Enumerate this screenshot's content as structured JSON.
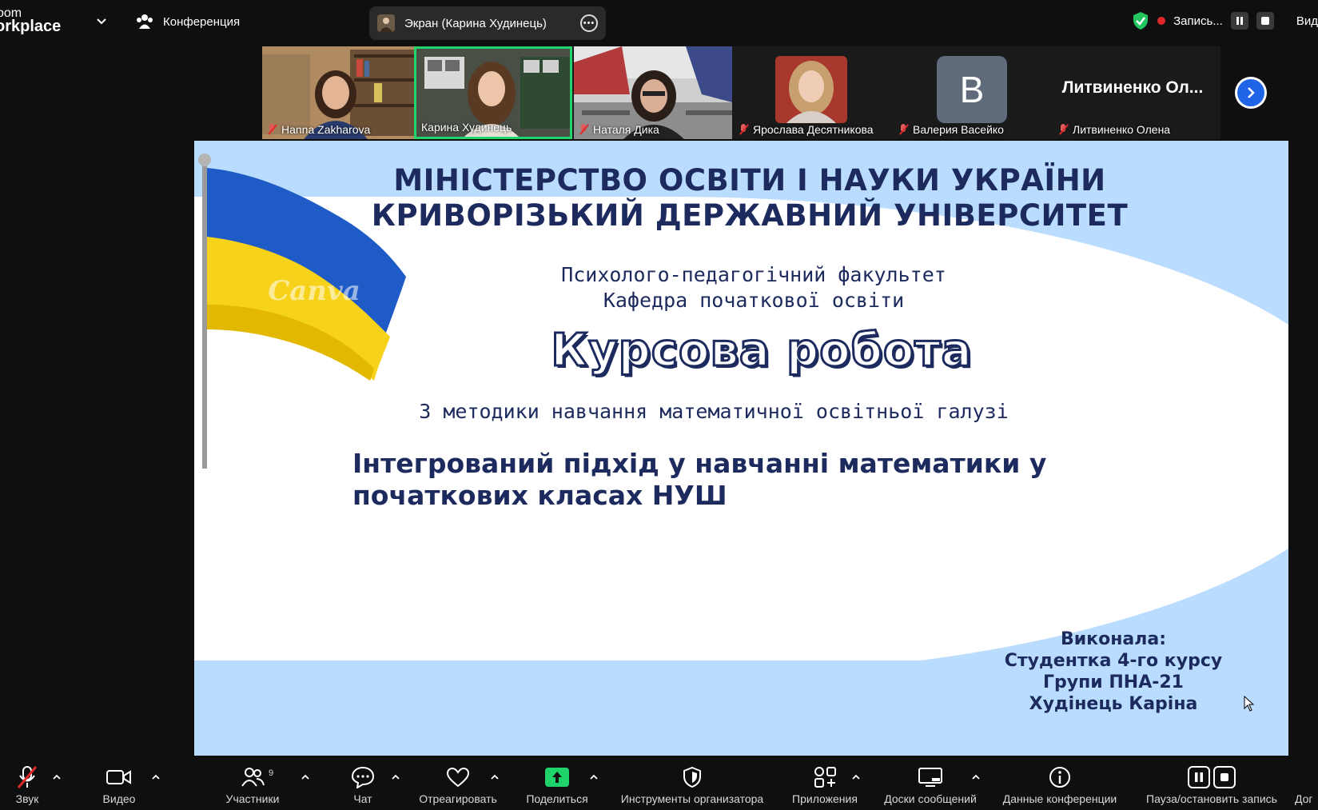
{
  "topbar": {
    "brand_line1": "oom",
    "brand_line2": "orkplace",
    "conference_label": "Конференция",
    "screen_share_label": "Экран (Карина Худинець)",
    "recording_label": "Запись...",
    "view_label": "Вид"
  },
  "participants": [
    {
      "name": "Hanna Zakharova",
      "muted": true
    },
    {
      "name": "Карина Худинець",
      "muted": false,
      "speaking": true
    },
    {
      "name": "Наталя Дика",
      "muted": true
    },
    {
      "name": "Ярослава Десятникова",
      "muted": true
    },
    {
      "name": "Валерия Васейко",
      "muted": true,
      "avatar_letter": "B"
    },
    {
      "name": "Литвиненко Олена",
      "muted": true,
      "display_name": "Литвиненко Ол..."
    }
  ],
  "slide": {
    "title_line1": "МІНІСТЕРСТВО ОСВІТИ І НАУКИ УКРАЇНИ",
    "title_line2": "КРИВОРІЗЬКИЙ ДЕРЖАВНИЙ УНІВЕРСИТЕТ",
    "faculty": "Психолого-педагогічний факультет",
    "department": "Кафедра початкової освіти",
    "heading": "Курсова робота",
    "subject": "З методики навчання математичної освітньої галузі",
    "topic_line1": "Інтегрований підхід у навчанні математики у",
    "topic_line2": "початкових класах НУШ",
    "author_line1": "Виконала:",
    "author_line2": "Студентка 4-го курсу",
    "author_line3": "Групи ПНА-21",
    "author_line4": "Худінець Каріна",
    "watermark": "Canva"
  },
  "toolbar": {
    "audio": "Звук",
    "video": "Видео",
    "participants": "Участники",
    "participants_count": "9",
    "chat": "Чат",
    "react": "Отреагировать",
    "share": "Поделиться",
    "host_tools": "Инструменты организатора",
    "apps": "Приложения",
    "whiteboards": "Доски сообщений",
    "meeting_info": "Данные конференции",
    "pause_stop_recording": "Пауза/остановить запись",
    "more": "Дог"
  },
  "colors": {
    "accent_green": "#22d46b",
    "share_green": "#1fd36b",
    "slide_navy": "#1c2a5e",
    "slide_blue": "#b9dcff",
    "record_red": "#e02828",
    "next_blue": "#1e64e6"
  }
}
